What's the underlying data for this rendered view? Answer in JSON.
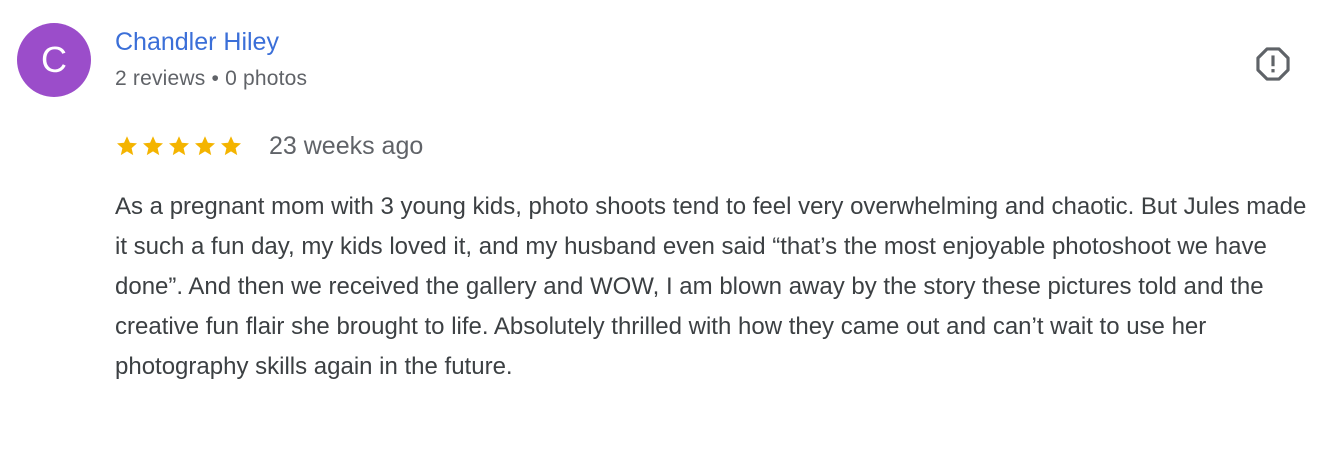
{
  "author": {
    "initial": "C",
    "name": "Chandler Hiley",
    "reviews": "2 reviews",
    "separator": "•",
    "photos": "0 photos"
  },
  "rating": {
    "stars": 5,
    "max_stars": 5,
    "star_color": "#f4b400",
    "time_ago": "23 weeks ago"
  },
  "review": {
    "text": "As a pregnant mom with 3 young kids, photo shoots tend to feel very overwhelming and chaotic. But Jules made it such a fun day, my kids loved it, and my husband even said “that’s the most enjoyable photoshoot we have done”. And then we received the gallery and WOW, I am blown away by the story these pictures told and the creative fun flair she brought to life. Absolutely thrilled with how they came out and can’t wait to use her photography skills again in the future."
  },
  "icons": {
    "flag": "report-flag-icon",
    "star": "star-icon"
  },
  "colors": {
    "avatar": "#9b4dca",
    "author_link": "#3b6fd8",
    "meta_text": "#606368",
    "body_text": "#3c4043"
  }
}
